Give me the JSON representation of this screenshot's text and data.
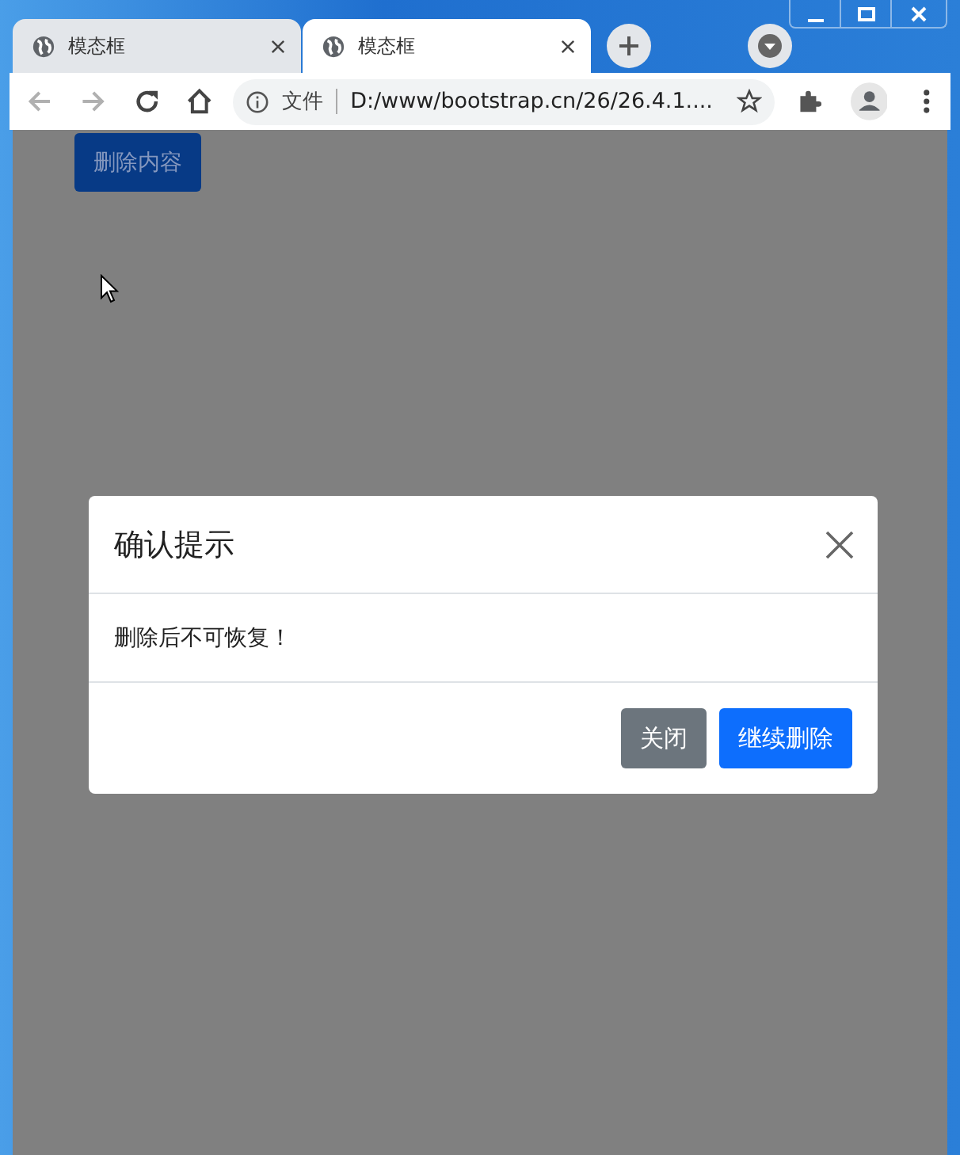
{
  "tabs": [
    {
      "title": "模态框",
      "selected": false
    },
    {
      "title": "模态框",
      "selected": true
    }
  ],
  "address_bar": {
    "security_label": "文件",
    "url": "D:/www/bootstrap.cn/26/26.4.1...."
  },
  "page": {
    "button": "删除内容"
  },
  "modal": {
    "title": "确认提示",
    "body": "删除后不可恢复！",
    "buttons": [
      {
        "label": "关闭",
        "kind": "secondary"
      },
      {
        "label": "继续删除",
        "kind": "primary"
      }
    ]
  }
}
